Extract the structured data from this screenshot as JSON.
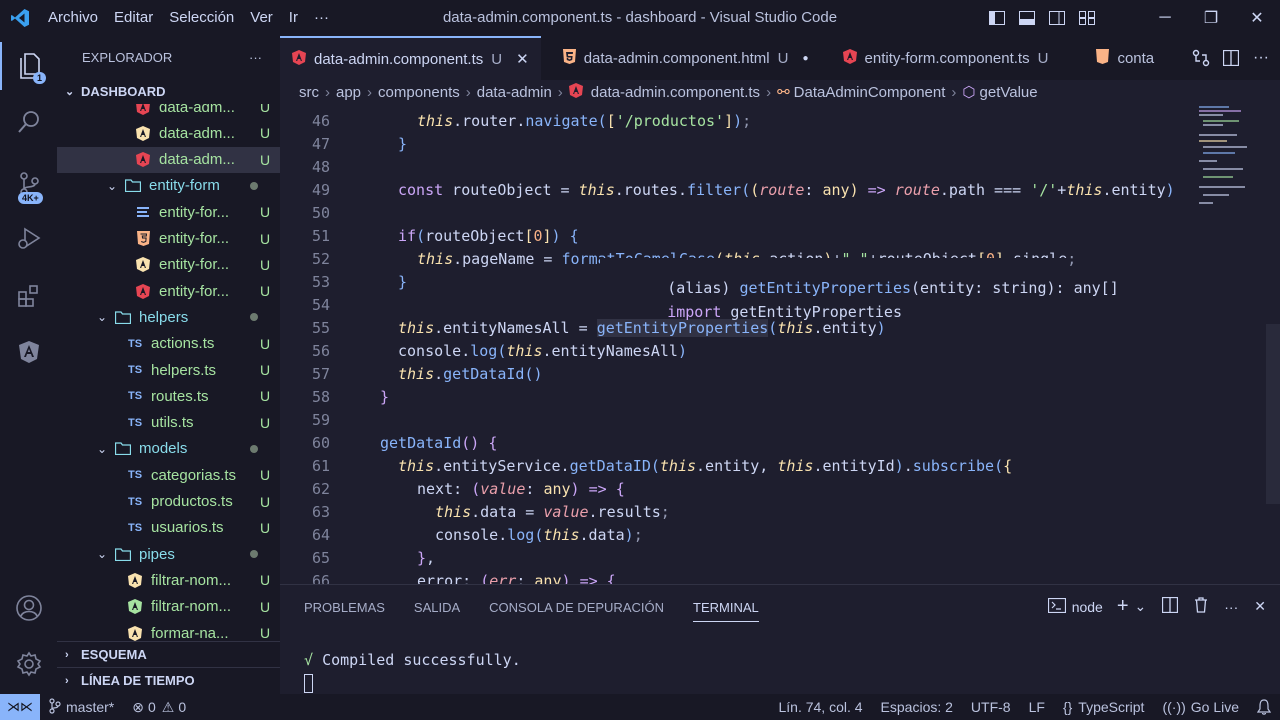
{
  "titlebar": {
    "menu": [
      "Archivo",
      "Editar",
      "Selección",
      "Ver",
      "Ir",
      "···"
    ],
    "title": "data-admin.component.ts - dashboard - Visual Studio Code"
  },
  "activity": {
    "explorer_badge": "1",
    "scm_badge": "4K+"
  },
  "sidebar": {
    "header": "EXPLORADOR",
    "more": "···",
    "workspace": "DASHBOARD",
    "rows": [
      {
        "name": "data-adm...",
        "status": "U",
        "icon": "angular"
      },
      {
        "name": "data-adm...",
        "status": "U",
        "icon": "angular-service"
      },
      {
        "name": "data-adm...",
        "status": "U",
        "icon": "angular"
      },
      {
        "name": "entity-form",
        "status": "",
        "icon": "folder"
      },
      {
        "name": "entity-for...",
        "status": "U",
        "icon": "css"
      },
      {
        "name": "entity-for...",
        "status": "U",
        "icon": "html"
      },
      {
        "name": "entity-for...",
        "status": "U",
        "icon": "angular-service"
      },
      {
        "name": "entity-for...",
        "status": "U",
        "icon": "angular"
      },
      {
        "name": "helpers",
        "status": "",
        "icon": "folder"
      },
      {
        "name": "actions.ts",
        "status": "U",
        "icon": "ts"
      },
      {
        "name": "helpers.ts",
        "status": "U",
        "icon": "ts"
      },
      {
        "name": "routes.ts",
        "status": "U",
        "icon": "ts"
      },
      {
        "name": "utils.ts",
        "status": "U",
        "icon": "ts"
      },
      {
        "name": "models",
        "status": "",
        "icon": "folder"
      },
      {
        "name": "categorias.ts",
        "status": "U",
        "icon": "ts"
      },
      {
        "name": "productos.ts",
        "status": "U",
        "icon": "ts"
      },
      {
        "name": "usuarios.ts",
        "status": "U",
        "icon": "ts"
      },
      {
        "name": "pipes",
        "status": "",
        "icon": "folder"
      },
      {
        "name": "filtrar-nom...",
        "status": "U",
        "icon": "angular-service"
      },
      {
        "name": "filtrar-nom...",
        "status": "U",
        "icon": "angular-green"
      },
      {
        "name": "formar-na...",
        "status": "U",
        "icon": "angular-service"
      }
    ],
    "outline": "ESQUEMA",
    "timeline": "LÍNEA DE TIEMPO"
  },
  "tabs": [
    {
      "label": "data-admin.component.ts",
      "mod": "U",
      "icon": "angular",
      "active": true
    },
    {
      "label": "data-admin.component.html",
      "mod": "U",
      "icon": "html"
    },
    {
      "label": "entity-form.component.ts",
      "mod": "U",
      "icon": "angular"
    },
    {
      "label": "conta",
      "mod": "",
      "icon": "html"
    }
  ],
  "breadcrumb": [
    "src",
    "app",
    "components",
    "data-admin",
    "data-admin.component.ts",
    "DataAdminComponent",
    "getValue"
  ],
  "editor": {
    "line_numbers": [
      "46",
      "47",
      "48",
      "49",
      "50",
      "51",
      "52",
      "53",
      "54",
      "55",
      "56",
      "57",
      "58",
      "59",
      "60",
      "61",
      "62",
      "63",
      "64",
      "65",
      "66"
    ],
    "hover": {
      "line1_prefix": "(alias) ",
      "line1_fn": "getEntityProperties",
      "line1_rest": "(entity: string): any[]",
      "line2_kw": "import ",
      "line2_name": "getEntityProperties"
    }
  },
  "panel": {
    "tabs": [
      "PROBLEMAS",
      "SALIDA",
      "CONSOLA DE DEPURACIÓN",
      "TERMINAL"
    ],
    "active_tab": "TERMINAL",
    "terminal_name": "node",
    "output_check": "√",
    "output_text": "Compiled successfully."
  },
  "status": {
    "branch": "master*",
    "errors": "0",
    "warnings": "0",
    "position": "Lín. 74, col. 4",
    "spaces": "Espacios: 2",
    "encoding": "UTF-8",
    "eol": "LF",
    "language": "TypeScript",
    "golive": "Go Live"
  },
  "colors": {
    "accent": "#89b4fa",
    "background": "#1e1e2e",
    "sidebar": "#181825",
    "untracked": "#a6e3a1"
  }
}
